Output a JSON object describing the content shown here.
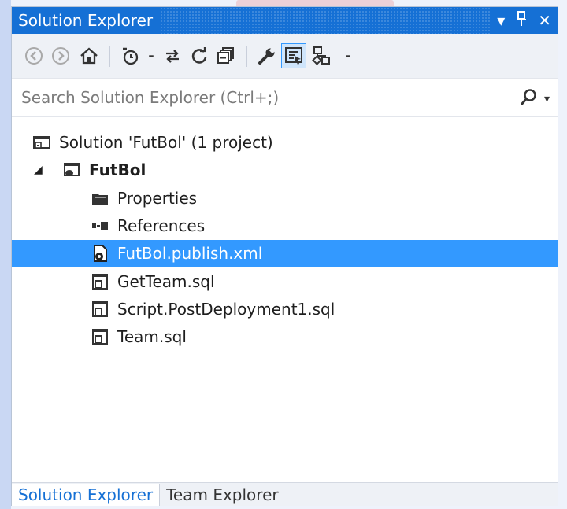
{
  "window": {
    "title": "Solution Explorer",
    "controls": [
      {
        "name": "dropdown-arrow-icon",
        "glyph": "▾"
      },
      {
        "name": "pin-icon",
        "glyph": "⊥"
      },
      {
        "name": "close-icon",
        "glyph": "✕"
      }
    ]
  },
  "toolbar": {
    "buttons": [
      "back-icon",
      "forward-icon",
      "home-icon",
      "pending-changes-icon",
      "dropdown-arrow-icon",
      "sync-icon",
      "refresh-icon",
      "collapse-all-icon",
      "properties-wrench-icon",
      "preview-selected-icon",
      "class-diagram-icon",
      "dropdown-arrow-icon"
    ],
    "active_button": "preview-selected-icon"
  },
  "search": {
    "placeholder": "Search Solution Explorer (Ctrl+;)"
  },
  "tree": {
    "items": [
      {
        "label": "Solution 'FutBol' (1 project)",
        "icon": "solution-icon",
        "level": 0,
        "bold": false,
        "selected": false
      },
      {
        "label": "FutBol",
        "icon": "database-project-icon",
        "level": 1,
        "bold": true,
        "selected": false,
        "expanded": true
      },
      {
        "label": "Properties",
        "icon": "folder-icon",
        "level": 2,
        "bold": false,
        "selected": false
      },
      {
        "label": "References",
        "icon": "references-icon",
        "level": 2,
        "bold": false,
        "selected": false
      },
      {
        "label": "FutBol.publish.xml",
        "icon": "publish-profile-icon",
        "level": 2,
        "bold": false,
        "selected": true
      },
      {
        "label": "GetTeam.sql",
        "icon": "sql-file-icon",
        "level": 2,
        "bold": false,
        "selected": false
      },
      {
        "label": "Script.PostDeployment1.sql",
        "icon": "sql-file-icon",
        "level": 2,
        "bold": false,
        "selected": false
      },
      {
        "label": "Team.sql",
        "icon": "sql-file-icon",
        "level": 2,
        "bold": false,
        "selected": false
      }
    ]
  },
  "bottom_tabs": [
    {
      "label": "Solution Explorer",
      "active": true
    },
    {
      "label": "Team Explorer",
      "active": false
    }
  ],
  "colors": {
    "accent": "#1570d5",
    "selection": "#3399ff",
    "toolbar_bg": "#eef1f6"
  }
}
